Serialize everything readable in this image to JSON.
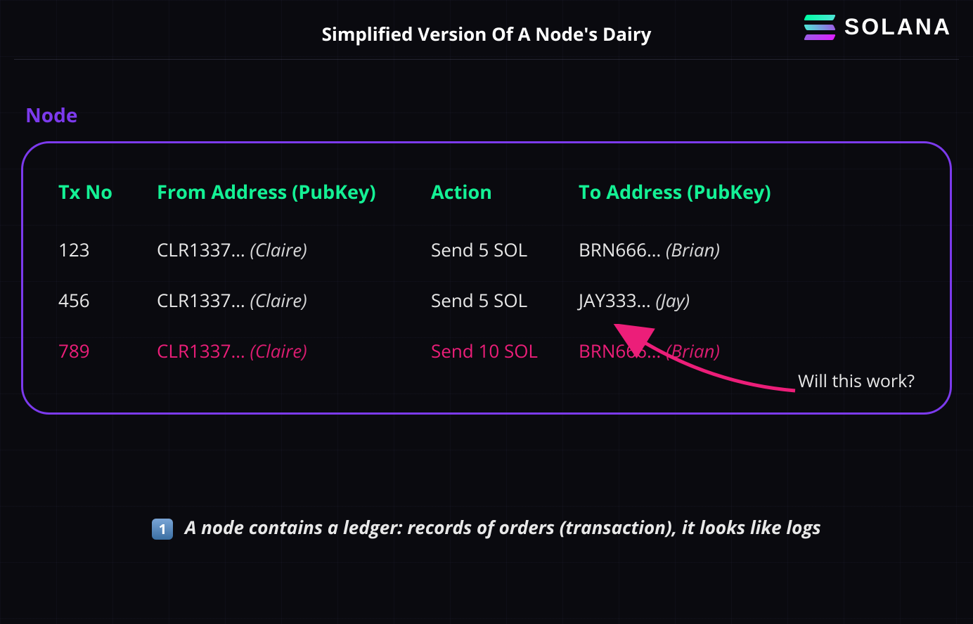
{
  "title": "Simplified Version Of A Node's Dairy",
  "brand": "SOLANA",
  "node_label": "Node",
  "table": {
    "headers": {
      "txno": "Tx No",
      "from": "From Address (PubKey)",
      "action": "Action",
      "to": "To Address (PubKey)"
    },
    "rows": [
      {
        "txno": "123",
        "from_addr": "CLR1337…",
        "from_name": "(Claire)",
        "action": "Send 5 SOL",
        "to_addr": "BRN666…",
        "to_name": "(Brian)",
        "highlight": false
      },
      {
        "txno": "456",
        "from_addr": "CLR1337…",
        "from_name": "(Claire)",
        "action": "Send 5 SOL",
        "to_addr": "JAY333…",
        "to_name": "(Jay)",
        "highlight": false
      },
      {
        "txno": "789",
        "from_addr": "CLR1337…",
        "from_name": "(Claire)",
        "action": "Send 10 SOL",
        "to_addr": "BRN666…",
        "to_name": "(Brian)",
        "highlight": true
      }
    ]
  },
  "annotation": "Will this work?",
  "caption_number": "1",
  "caption": "A node contains a ledger: records of orders (transaction), it looks like logs",
  "colors": {
    "accent_green": "#14f195",
    "accent_purple": "#7c3aed",
    "highlight_pink": "#ec1e79",
    "bg": "#0a0a0f"
  }
}
